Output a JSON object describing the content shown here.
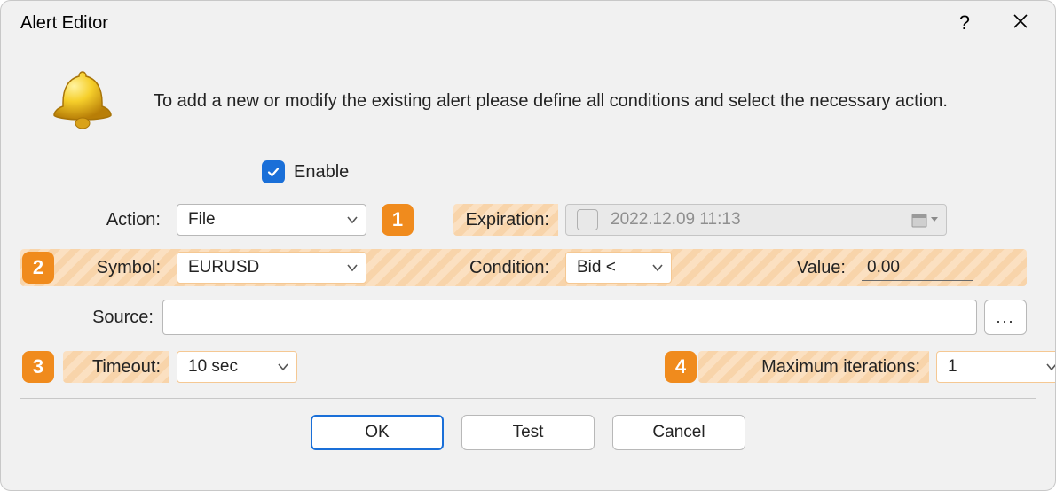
{
  "window": {
    "title": "Alert Editor"
  },
  "intro": "To add a new or modify the existing alert please define all conditions and select the necessary action.",
  "enable": {
    "label": "Enable",
    "checked": true
  },
  "action": {
    "label": "Action:",
    "value": "File"
  },
  "expiration": {
    "label": "Expiration:",
    "value": "2022.12.09 11:13",
    "checked": false
  },
  "symbol": {
    "label": "Symbol:",
    "value": "EURUSD"
  },
  "condition": {
    "label": "Condition:",
    "value": "Bid <"
  },
  "valuefield": {
    "label": "Value:",
    "value": "0.00"
  },
  "source": {
    "label": "Source:",
    "browse": "..."
  },
  "timeout": {
    "label": "Timeout:",
    "value": "10 sec"
  },
  "maxiter": {
    "label": "Maximum iterations:",
    "value": "1"
  },
  "markers": {
    "m1": "1",
    "m2": "2",
    "m3": "3",
    "m4": "4"
  },
  "buttons": {
    "ok": "OK",
    "test": "Test",
    "cancel": "Cancel"
  }
}
